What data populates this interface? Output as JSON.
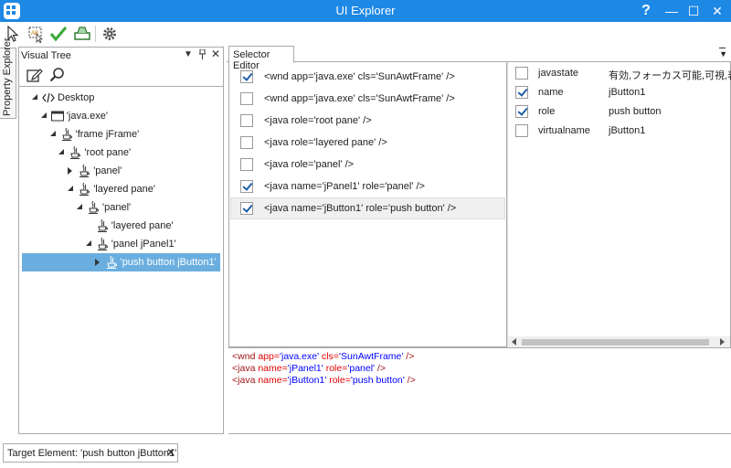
{
  "window": {
    "title": "UI Explorer",
    "help": "?",
    "minimize": "—",
    "maximize": "☐",
    "close": "✕"
  },
  "side_tab": {
    "label": "Property Explorer"
  },
  "visual_tree": {
    "title": "Visual Tree",
    "nodes": [
      {
        "label": "Desktop",
        "level": 0,
        "expander": "open",
        "icon": "code-icon"
      },
      {
        "label": "'java.exe'",
        "level": 1,
        "expander": "open",
        "icon": "window-icon"
      },
      {
        "label": "'frame  jFrame'",
        "level": 2,
        "expander": "open",
        "icon": "java-icon"
      },
      {
        "label": "'root pane'",
        "level": 3,
        "expander": "open",
        "icon": "java-icon"
      },
      {
        "label": "'panel'",
        "level": 4,
        "expander": "closed",
        "icon": "java-icon"
      },
      {
        "label": "'layered pane'",
        "level": 4,
        "expander": "open",
        "icon": "java-icon"
      },
      {
        "label": "'panel'",
        "level": 5,
        "expander": "open",
        "icon": "java-icon"
      },
      {
        "label": "'layered pane'",
        "level": 6,
        "expander": "none",
        "icon": "java-icon"
      },
      {
        "label": "'panel  jPanel1'",
        "level": 6,
        "expander": "open",
        "icon": "java-icon"
      },
      {
        "label": "'push button  jButton1'",
        "level": 7,
        "expander": "closed",
        "icon": "java-icon",
        "selected": true
      }
    ]
  },
  "selector_editor": {
    "tab_label": "Selector Editor",
    "rows": [
      {
        "text": "<wnd app='java.exe' cls='SunAwtFrame' />",
        "checked": true
      },
      {
        "text": "<wnd app='java.exe' cls='SunAwtFrame' />",
        "checked": false
      },
      {
        "text": "<java role='root pane' />",
        "checked": false
      },
      {
        "text": "<java role='layered pane' />",
        "checked": false
      },
      {
        "text": "<java role='panel' />",
        "checked": false
      },
      {
        "text": "<java name='jPanel1' role='panel' />",
        "checked": true
      },
      {
        "text": "<java name='jButton1' role='push button' />",
        "checked": true,
        "highlighted": true
      }
    ]
  },
  "attributes": [
    {
      "name": "javastate",
      "value": "有効,フォーカス可能,可視,表示",
      "checked": false
    },
    {
      "name": "name",
      "value": "jButton1",
      "checked": true
    },
    {
      "name": "role",
      "value": "push button",
      "checked": true
    },
    {
      "name": "virtualname",
      "value": "jButton1",
      "checked": false
    }
  ],
  "xml_preview": [
    {
      "tag": "wnd",
      "attrs": [
        {
          "n": "app",
          "v": "'java.exe'"
        },
        {
          "n": "cls",
          "v": "'SunAwtFrame'"
        }
      ]
    },
    {
      "tag": "java",
      "attrs": [
        {
          "n": "name",
          "v": "'jPanel1'"
        },
        {
          "n": "role",
          "v": "'panel'"
        }
      ]
    },
    {
      "tag": "java",
      "attrs": [
        {
          "n": "name",
          "v": "'jButton1'"
        },
        {
          "n": "role",
          "v": "'push button'"
        }
      ]
    }
  ],
  "status": {
    "target_element": "Target Element: 'push button  jButton1'",
    "close": "✕"
  },
  "colors": {
    "title_bar": "#1e88e5",
    "selection": "#6aaee0",
    "check": "#1f5fa8"
  }
}
